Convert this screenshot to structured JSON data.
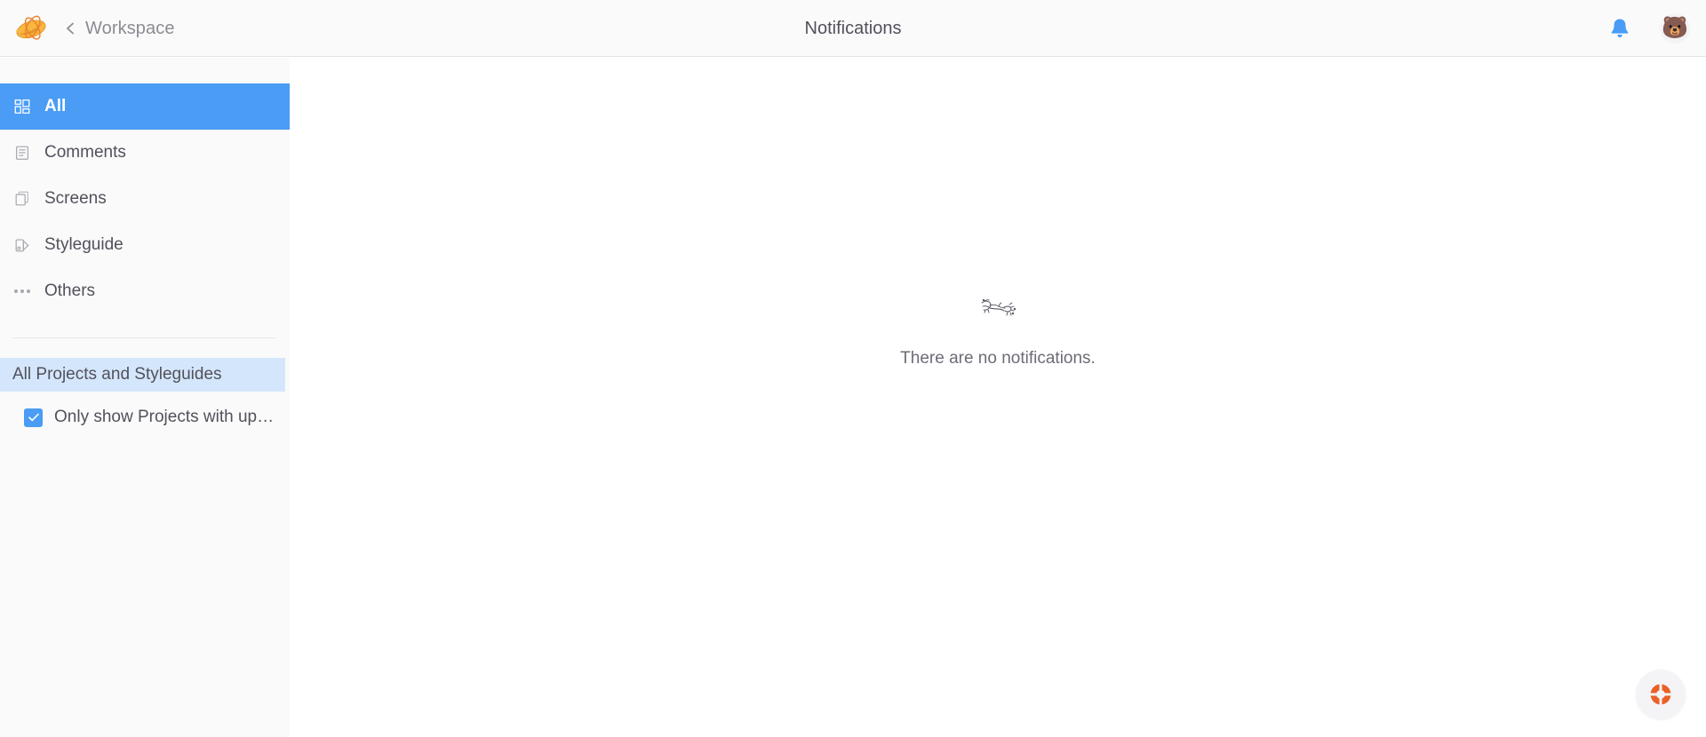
{
  "header": {
    "logo_icon": "zeppelin-logo-icon",
    "back_icon": "chevron-left-icon",
    "workspace_label": "Workspace",
    "title": "Notifications",
    "bell_icon": "bell-icon",
    "avatar_glyph": "🐻",
    "accent_blue": "#4a9cf5",
    "bar_background": "#fafafa",
    "title_color": "#51515c"
  },
  "sidebar": {
    "background": "#fafafa",
    "active_background": "#4a9cf5",
    "scope_background": "#d4e6fb",
    "items": [
      {
        "label": "All",
        "icon": "grid-icon",
        "active": true
      },
      {
        "label": "Comments",
        "icon": "comment-document-icon",
        "active": false
      },
      {
        "label": "Screens",
        "icon": "screens-stack-icon",
        "active": false
      },
      {
        "label": "Styleguide",
        "icon": "styleguide-tag-icon",
        "active": false
      },
      {
        "label": "Others",
        "icon": "ellipsis-icon",
        "active": false
      }
    ],
    "scope": {
      "label": "All Projects and Styleguides",
      "selected": true
    },
    "filter": {
      "label": "Only show Projects with up…",
      "checked": true,
      "check_icon": "checkmark-icon"
    }
  },
  "main": {
    "empty_state": {
      "illustration_icon": "no-notifications-illustration-icon",
      "message": "There are no notifications."
    }
  },
  "help": {
    "icon": "lifebuoy-help-icon",
    "color": "#ea6026",
    "background": "#f4f4f6"
  }
}
